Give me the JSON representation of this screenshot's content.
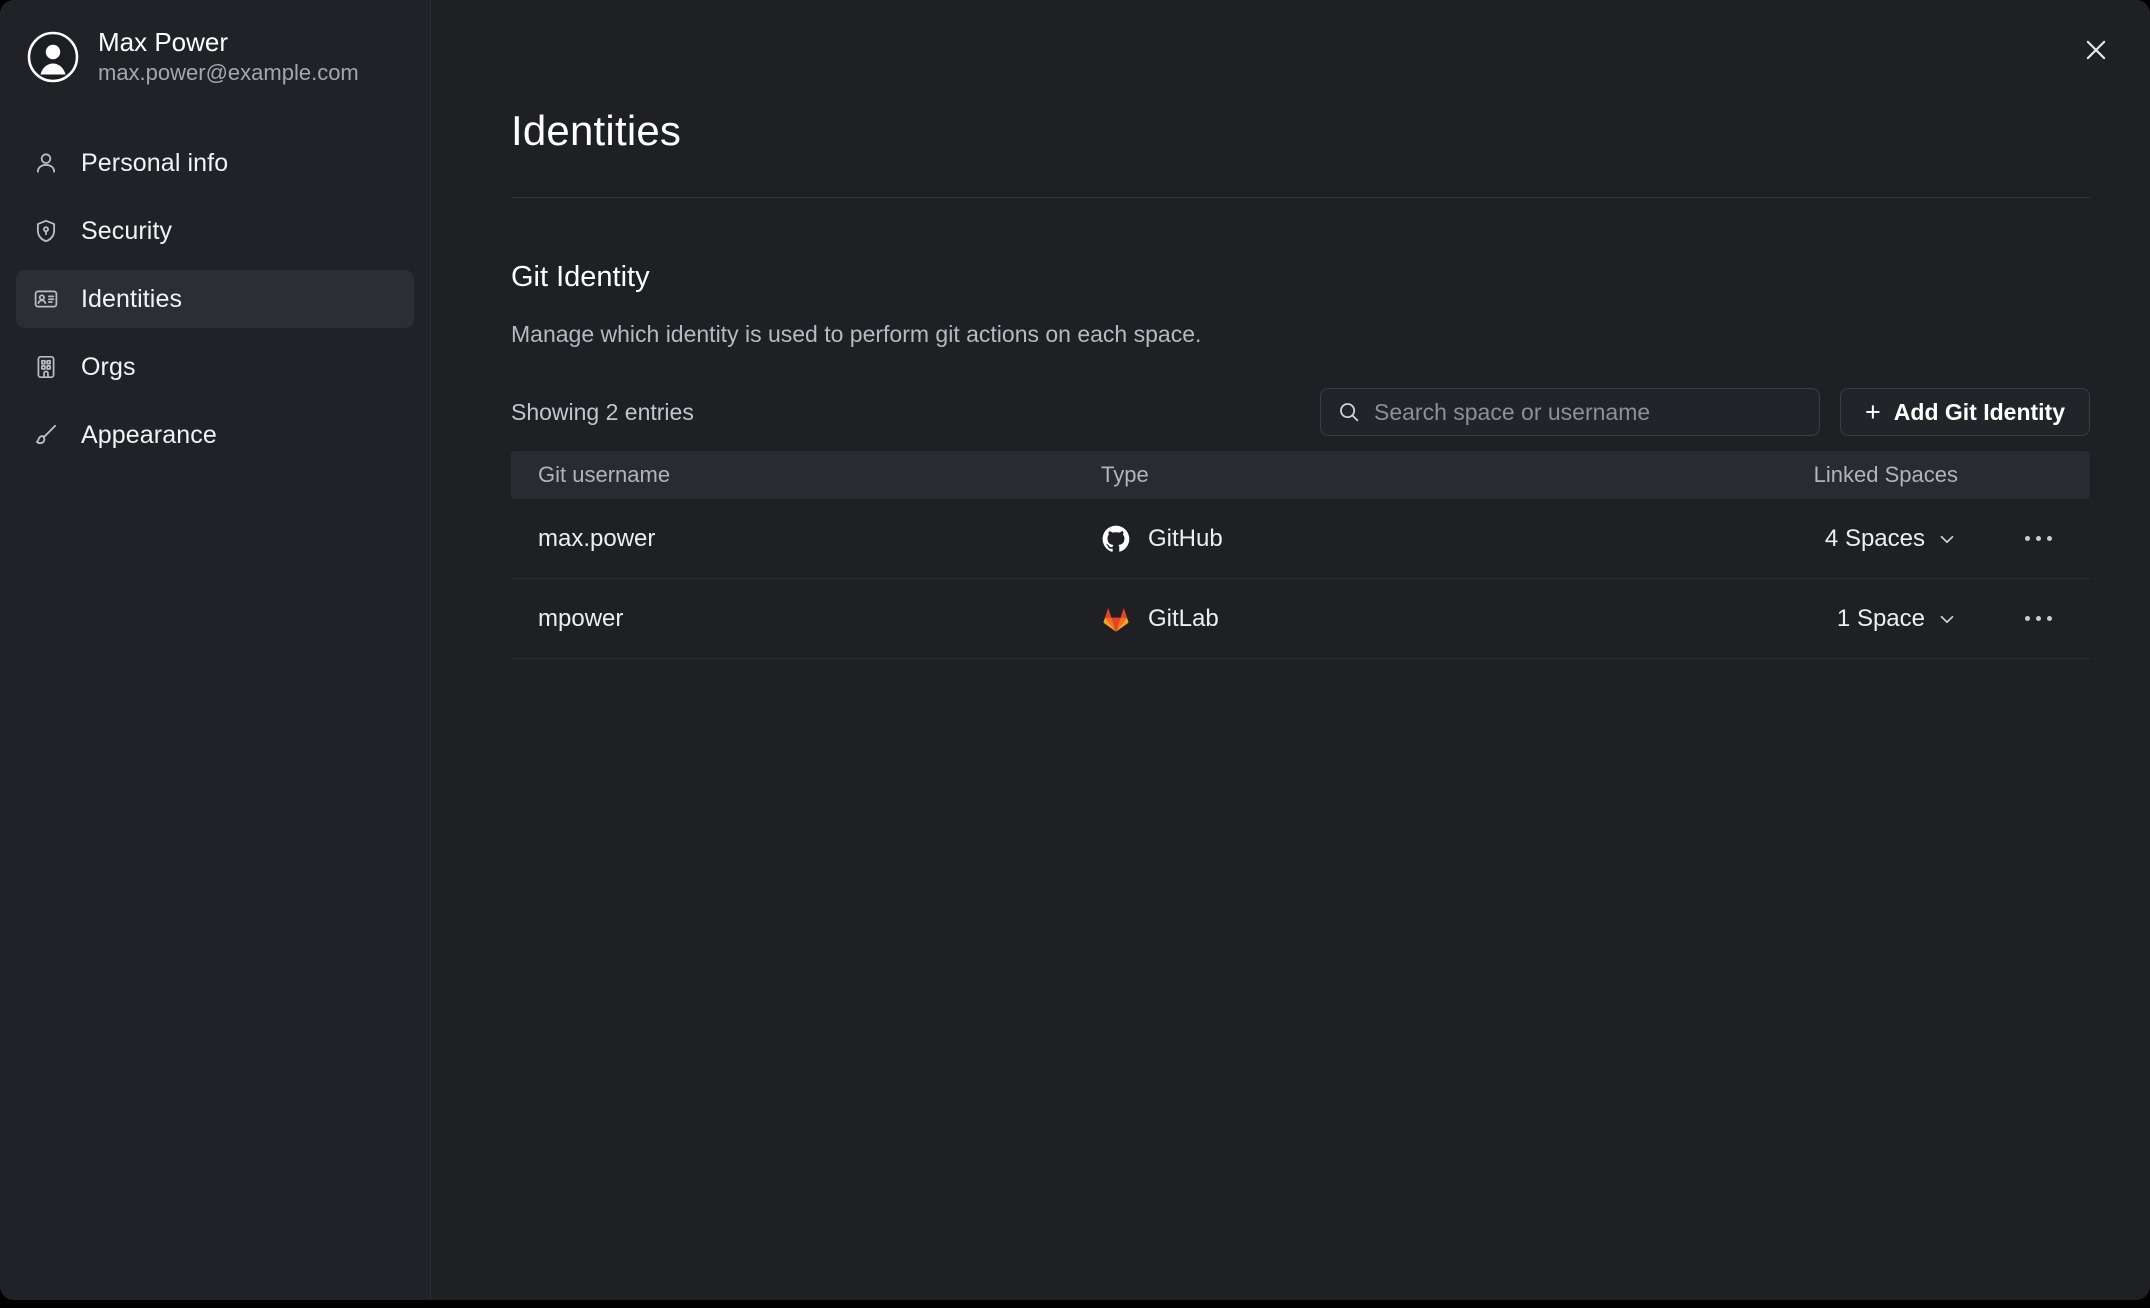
{
  "profile": {
    "name": "Max Power",
    "email": "max.power@example.com",
    "avatar_icon": "user-circle-icon"
  },
  "sidebar": {
    "items": [
      {
        "label": "Personal info",
        "icon": "user-icon",
        "active": false
      },
      {
        "label": "Security",
        "icon": "shield-icon",
        "active": false
      },
      {
        "label": "Identities",
        "icon": "id-card-icon",
        "active": true
      },
      {
        "label": "Orgs",
        "icon": "building-icon",
        "active": false
      },
      {
        "label": "Appearance",
        "icon": "brush-icon",
        "active": false
      }
    ]
  },
  "header": {
    "title": "Identities",
    "close_icon": "close-icon"
  },
  "section": {
    "title": "Git Identity",
    "description": "Manage which identity is used to perform git actions on each space."
  },
  "toolbar": {
    "entries_text": "Showing 2 entries",
    "search": {
      "value": "",
      "placeholder": "Search space or username",
      "icon": "search-icon"
    },
    "add_button": {
      "label": "Add Git Identity",
      "icon": "plus-icon"
    }
  },
  "table": {
    "columns": [
      "Git username",
      "Type",
      "Linked Spaces"
    ],
    "rows": [
      {
        "username": "max.power",
        "type": "GitHub",
        "type_icon": "github-icon",
        "linked_spaces": "4 Spaces",
        "chevron_icon": "chevron-down-icon",
        "menu_icon": "more-horizontal-icon"
      },
      {
        "username": "mpower",
        "type": "GitLab",
        "type_icon": "gitlab-icon",
        "linked_spaces": "1 Space",
        "chevron_icon": "chevron-down-icon",
        "menu_icon": "more-horizontal-icon"
      }
    ]
  },
  "colors": {
    "window_bg": "#1e2024",
    "sidebar_bg": "#202227",
    "active_item": "#2b2e35",
    "table_header": "#282b31",
    "text_primary": "#ffffff",
    "text_secondary": "#b0b4bb",
    "gitlab_orange": "#e24329",
    "gitlab_amber": "#fc6d26",
    "gitlab_yellow": "#fca326"
  }
}
